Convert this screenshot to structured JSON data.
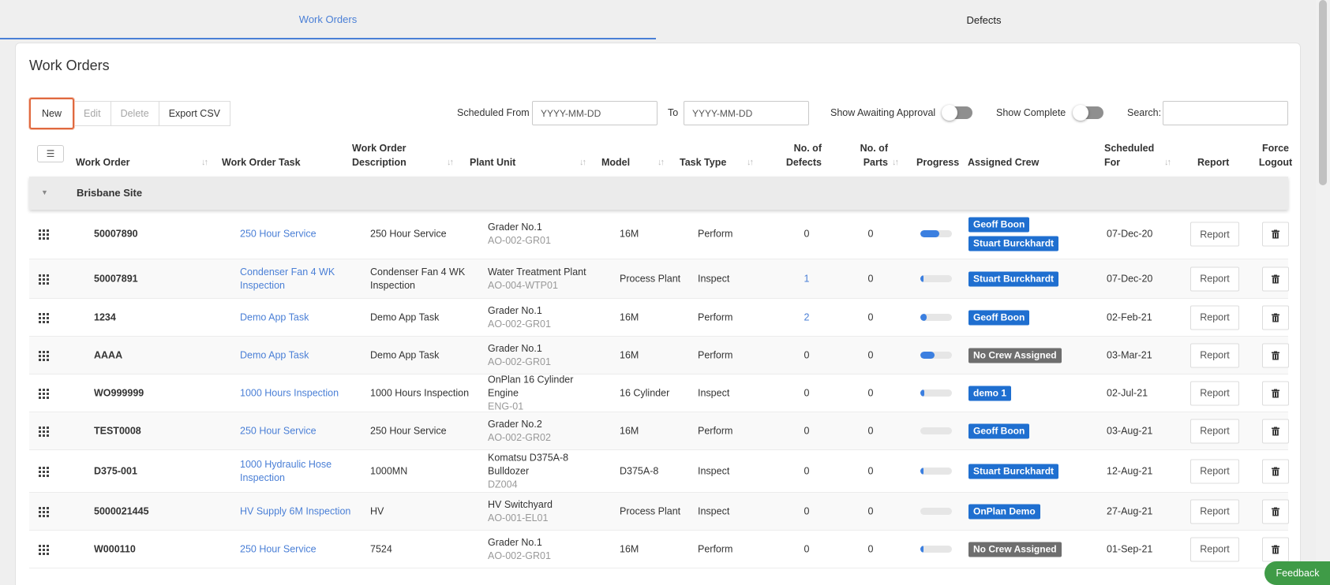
{
  "tabs": [
    {
      "label": "Work Orders",
      "active": true
    },
    {
      "label": "Defects",
      "active": false
    }
  ],
  "page_title": "Work Orders",
  "toolbar": {
    "new_label": "New",
    "edit_label": "Edit",
    "delete_label": "Delete",
    "export_label": "Export CSV"
  },
  "filters": {
    "scheduled_from_label": "Scheduled From",
    "scheduled_from_placeholder": "YYYY-MM-DD",
    "to_label": "To",
    "to_placeholder": "YYYY-MM-DD",
    "awaiting_approval_label": "Show Awaiting Approval",
    "awaiting_approval_on": false,
    "show_complete_label": "Show Complete",
    "show_complete_on": false,
    "search_label": "Search:",
    "search_value": ""
  },
  "columns": {
    "work_order": "Work Order",
    "task": "Work Order Task",
    "description": "Work Order Description",
    "plant_unit": "Plant Unit",
    "model": "Model",
    "task_type": "Task Type",
    "defects": "No. of Defects",
    "parts": "No. of Parts",
    "progress": "Progress",
    "crew": "Assigned Crew",
    "scheduled": "Scheduled For",
    "report": "Report",
    "force_logout": "Force Logout"
  },
  "group": {
    "name": "Brisbane Site"
  },
  "report_label": "Report",
  "rows": [
    {
      "wo": "50007890",
      "task": "250 Hour Service",
      "desc": "250 Hour Service",
      "plant": "Grader No.1",
      "plant_code": "AO-002-GR01",
      "model": "16M",
      "type": "Perform",
      "defects": "0",
      "defects_link": false,
      "parts": "0",
      "progress": 0.6,
      "crew": [
        {
          "name": "Geoff Boon",
          "color": "blue"
        },
        {
          "name": "Stuart Burckhardt",
          "color": "blue"
        }
      ],
      "scheduled": "07-Dec-20"
    },
    {
      "wo": "50007891",
      "task": "Condenser Fan 4 WK Inspection",
      "desc": "Condenser Fan 4 WK Inspection",
      "plant": "Water Treatment Plant",
      "plant_code": "AO-004-WTP01",
      "model": "Process Plant",
      "type": "Inspect",
      "defects": "1",
      "defects_link": true,
      "parts": "0",
      "progress": 0.1,
      "crew": [
        {
          "name": "Stuart Burckhardt",
          "color": "blue"
        }
      ],
      "scheduled": "07-Dec-20"
    },
    {
      "wo": "1234",
      "task": "Demo App Task",
      "desc": "Demo App Task",
      "plant": "Grader No.1",
      "plant_code": "AO-002-GR01",
      "model": "16M",
      "type": "Perform",
      "defects": "2",
      "defects_link": true,
      "parts": "0",
      "progress": 0.2,
      "crew": [
        {
          "name": "Geoff Boon",
          "color": "blue"
        }
      ],
      "scheduled": "02-Feb-21"
    },
    {
      "wo": "AAAA",
      "task": "Demo App Task",
      "desc": "Demo App Task",
      "plant": "Grader No.1",
      "plant_code": "AO-002-GR01",
      "model": "16M",
      "type": "Perform",
      "defects": "0",
      "defects_link": false,
      "parts": "0",
      "progress": 0.45,
      "crew": [
        {
          "name": "No Crew Assigned",
          "color": "grey"
        }
      ],
      "scheduled": "03-Mar-21"
    },
    {
      "wo": "WO999999",
      "task": "1000 Hours Inspection",
      "desc": "1000 Hours Inspection",
      "plant": "OnPlan 16 Cylinder Engine",
      "plant_code": "ENG-01",
      "model": "16 Cylinder",
      "type": "Inspect",
      "defects": "0",
      "defects_link": false,
      "parts": "0",
      "progress": 0.12,
      "crew": [
        {
          "name": "demo 1",
          "color": "blue"
        }
      ],
      "scheduled": "02-Jul-21"
    },
    {
      "wo": "TEST0008",
      "task": "250 Hour Service",
      "desc": "250 Hour Service",
      "plant": "Grader No.2",
      "plant_code": "AO-002-GR02",
      "model": "16M",
      "type": "Perform",
      "defects": "0",
      "defects_link": false,
      "parts": "0",
      "progress": 0,
      "crew": [
        {
          "name": "Geoff Boon",
          "color": "blue"
        }
      ],
      "scheduled": "03-Aug-21"
    },
    {
      "wo": "D375-001",
      "task": "1000 Hydraulic Hose Inspection",
      "desc": "1000MN",
      "plant": "Komatsu D375A-8 Bulldozer",
      "plant_code": "DZ004",
      "model": "D375A-8",
      "type": "Inspect",
      "defects": "0",
      "defects_link": false,
      "parts": "0",
      "progress": 0.1,
      "crew": [
        {
          "name": "Stuart Burckhardt",
          "color": "blue"
        }
      ],
      "scheduled": "12-Aug-21"
    },
    {
      "wo": "5000021445",
      "task": "HV Supply 6M Inspection",
      "desc": "HV",
      "plant": "HV Switchyard",
      "plant_code": "AO-001-EL01",
      "model": "Process Plant",
      "type": "Inspect",
      "defects": "0",
      "defects_link": false,
      "parts": "0",
      "progress": 0,
      "crew": [
        {
          "name": "OnPlan Demo",
          "color": "blue"
        }
      ],
      "scheduled": "27-Aug-21"
    },
    {
      "wo": "W000110",
      "task": "250 Hour Service",
      "desc": "7524",
      "plant": "Grader No.1",
      "plant_code": "AO-002-GR01",
      "model": "16M",
      "type": "Perform",
      "defects": "0",
      "defects_link": false,
      "parts": "0",
      "progress": 0.1,
      "crew": [
        {
          "name": "No Crew Assigned",
          "color": "grey"
        }
      ],
      "scheduled": "01-Sep-21"
    }
  ],
  "feedback_label": "Feedback"
}
